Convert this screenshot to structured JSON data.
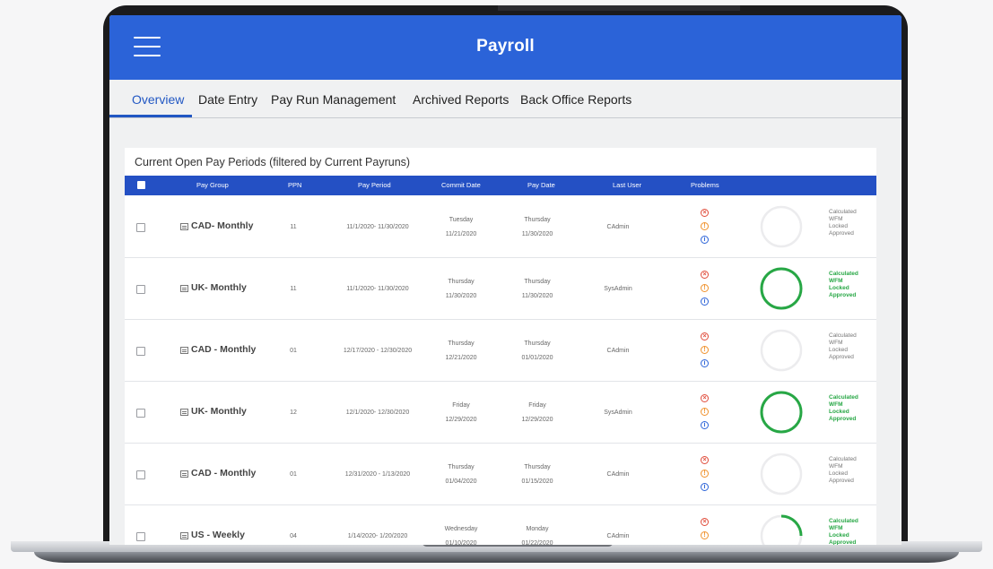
{
  "app": {
    "title": "Payroll"
  },
  "tabs": [
    {
      "label": "Overview",
      "active": true
    },
    {
      "label": "Date Entry",
      "active": false
    },
    {
      "label": "Pay Run Management",
      "active": false
    },
    {
      "label": "Archived Reports",
      "active": false
    },
    {
      "label": "Back Office Reports",
      "active": false
    }
  ],
  "card": {
    "title": "Current Open Pay Periods (filtered by Current Payruns)"
  },
  "table": {
    "columns": [
      "Pay Group",
      "PPN",
      "Pay Period",
      "Commit Date",
      "Pay Date",
      "Last User",
      "Problems"
    ],
    "status_labels": [
      "Calculated",
      "WFM",
      "Locked",
      "Approved"
    ],
    "rows": [
      {
        "pay_group": "CAD- Monthly",
        "ppn": "11",
        "pay_period": "11/1/2020- 11/30/2020",
        "commit_day": "Tuesday",
        "commit_date": "11/21/2020",
        "pay_day": "Thursday",
        "pay_date": "11/30/2020",
        "last_user": "CAdmin",
        "progress": 0,
        "complete": false
      },
      {
        "pay_group": "UK- Monthly",
        "ppn": "11",
        "pay_period": "11/1/2020- 11/30/2020",
        "commit_day": "Thursday",
        "commit_date": "11/30/2020",
        "pay_day": "Thursday",
        "pay_date": "11/30/2020",
        "last_user": "SysAdmin",
        "progress": 1,
        "complete": true
      },
      {
        "pay_group": "CAD - Monthly",
        "ppn": "01",
        "pay_period": "12/17/2020 - 12/30/2020",
        "commit_day": "Thursday",
        "commit_date": "12/21/2020",
        "pay_day": "Thursday",
        "pay_date": "01/01/2020",
        "last_user": "CAdmin",
        "progress": 0,
        "complete": false
      },
      {
        "pay_group": "UK- Monthly",
        "ppn": "12",
        "pay_period": "12/1/2020- 12/30/2020",
        "commit_day": "Friday",
        "commit_date": "12/29/2020",
        "pay_day": "Friday",
        "pay_date": "12/29/2020",
        "last_user": "SysAdmin",
        "progress": 1,
        "complete": true
      },
      {
        "pay_group": "CAD - Monthly",
        "ppn": "01",
        "pay_period": "12/31/2020 - 1/13/2020",
        "commit_day": "Thursday",
        "commit_date": "01/04/2020",
        "pay_day": "Thursday",
        "pay_date": "01/15/2020",
        "last_user": "CAdmin",
        "progress": 0,
        "complete": false
      },
      {
        "pay_group": "US - Weekly",
        "ppn": "04",
        "pay_period": "1/14/2020- 1/20/2020",
        "commit_day": "Wednesday",
        "commit_date": "01/10/2020",
        "pay_day": "Monday",
        "pay_date": "01/22/2020",
        "last_user": "CAdmin",
        "progress": 0.25,
        "complete": true
      }
    ]
  },
  "colors": {
    "accent": "#2b63d8",
    "header_row": "#2450c4",
    "success": "#27a745",
    "error": "#e04b3a",
    "warning": "#f0922c"
  }
}
